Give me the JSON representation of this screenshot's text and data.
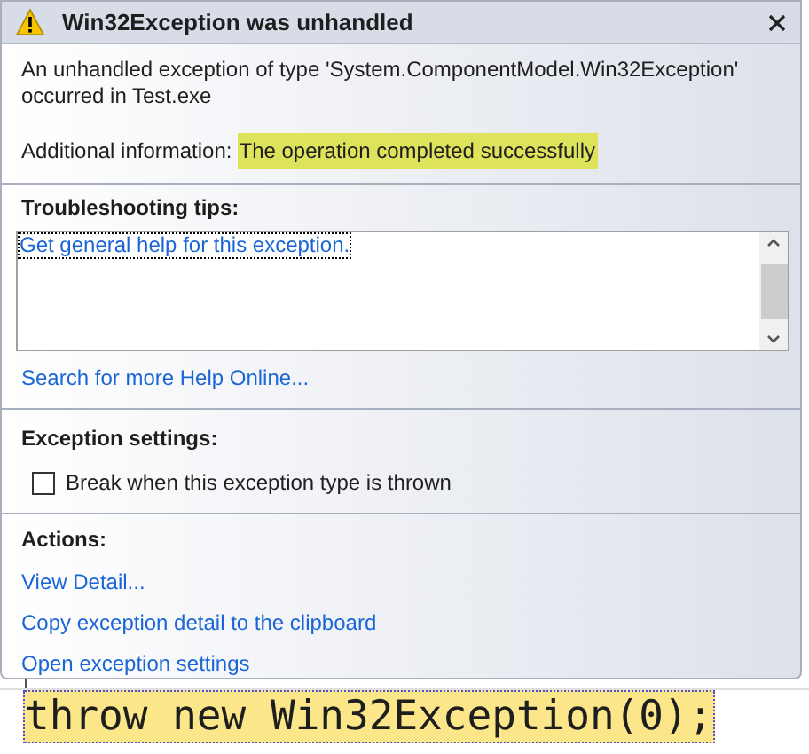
{
  "dialog": {
    "title": "Win32Exception was unhandled",
    "message": "An unhandled exception of type 'System.ComponentModel.Win32Exception' occurred in Test.exe",
    "info_label": "Additional information:",
    "info_value": "The operation completed successfully"
  },
  "troubleshooting": {
    "heading": "Troubleshooting tips:",
    "tips": [
      "Get general help for this exception."
    ],
    "search_link": "Search for more Help Online..."
  },
  "exception_settings": {
    "heading": "Exception settings:",
    "options": [
      {
        "label": "Break when this exception type is thrown",
        "checked": false
      }
    ]
  },
  "actions": {
    "heading": "Actions:",
    "links": [
      "View Detail...",
      "Copy exception detail to the clipboard",
      "Open exception settings"
    ]
  },
  "code_line": "throw new Win32Exception(0);"
}
